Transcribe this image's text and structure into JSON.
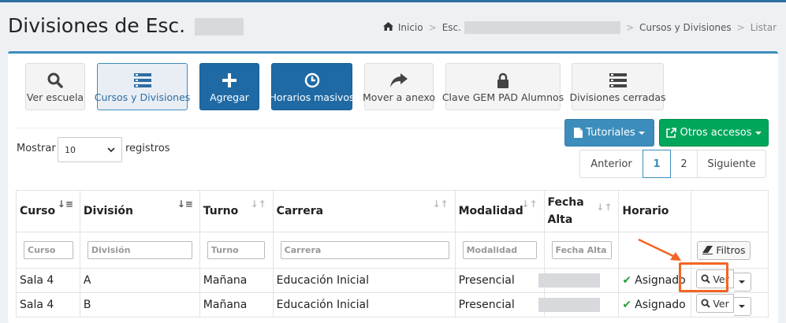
{
  "header": {
    "title": "Divisiones de Esc.",
    "breadcrumb": {
      "home": "Inicio",
      "school": "Esc.",
      "section": "Cursos y Divisiones",
      "current": "Listar"
    }
  },
  "toolbar": {
    "buttons": [
      {
        "label": "Ver escuela",
        "icon": "search-icon"
      },
      {
        "label": "Cursos y Divisiones",
        "icon": "list-icon"
      },
      {
        "label": "Agregar",
        "icon": "plus-icon"
      },
      {
        "label": "Horarios masivos",
        "icon": "clock-icon"
      },
      {
        "label": "Mover a anexo",
        "icon": "share-arrow-icon"
      },
      {
        "label": "Clave GEM PAD Alumnos",
        "icon": "lock-icon"
      },
      {
        "label": "Divisiones cerradas",
        "icon": "list-icon"
      }
    ]
  },
  "actions": {
    "tutoriales": "Tutoriales",
    "otros": "Otros accesos"
  },
  "length": {
    "prefix": "Mostrar",
    "value": "10",
    "suffix": "registros"
  },
  "pagination": {
    "prev": "Anterior",
    "pages": [
      "1",
      "2"
    ],
    "next": "Siguiente"
  },
  "table": {
    "headers": [
      "Curso",
      "División",
      "Turno",
      "Carrera",
      "Modalidad",
      "Fecha Alta",
      "Horario",
      ""
    ],
    "filters": [
      "Curso",
      "División",
      "Turno",
      "Carrera",
      "Modalidad",
      "Fecha Alta"
    ],
    "filter_button": "Filtros",
    "rows": [
      {
        "curso": "Sala 4",
        "division": "A",
        "turno": "Mañana",
        "carrera": "Educación Inicial",
        "modalidad": "Presencial",
        "horario": "Asignado",
        "accion": "Ver"
      },
      {
        "curso": "Sala 4",
        "division": "B",
        "turno": "Mañana",
        "carrera": "Educación Inicial",
        "modalidad": "Presencial",
        "horario": "Asignado",
        "accion": "Ver"
      }
    ]
  },
  "colors": {
    "primary": "#1f6aa5",
    "info": "#3c8dbc",
    "success": "#00a65a",
    "highlight": "#f26522",
    "check": "#2e9e46"
  }
}
